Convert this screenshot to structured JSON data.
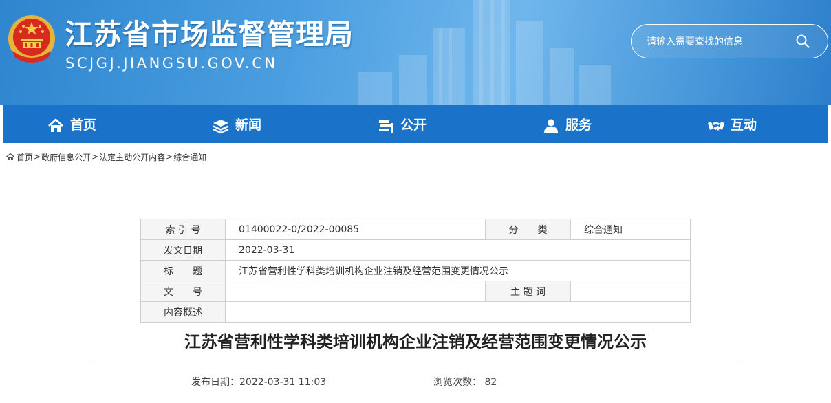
{
  "header": {
    "title": "江苏省市场监督管理局",
    "domain": "SCJGJ.JIANGSU.GOV.CN",
    "search_placeholder": "请输入需要查找的信息",
    "colors": {
      "banner": "#3b8fd7",
      "nav": "#1a73c9"
    }
  },
  "nav": {
    "items": [
      {
        "label": "首页",
        "icon": "home-icon"
      },
      {
        "label": "新闻",
        "icon": "layers-icon"
      },
      {
        "label": "公开",
        "icon": "stack-icon"
      },
      {
        "label": "服务",
        "icon": "user-icon"
      },
      {
        "label": "互动",
        "icon": "handshake-icon"
      }
    ]
  },
  "breadcrumb": {
    "items": [
      "首页",
      "政府信息公开",
      "法定主动公开内容",
      "综合通知"
    ],
    "separator": ">"
  },
  "info_table": {
    "index_label": "索 引 号",
    "index_value": "01400022-0/2022-00085",
    "category_label": "分　　类",
    "category_value": "综合通知",
    "date_label": "发文日期",
    "date_value": "2022-03-31",
    "title_label": "标　　题",
    "title_value": "江苏省营利性学科类培训机构企业注销及经营范围变更情况公示",
    "docno_label": "文　　号",
    "docno_value": "",
    "keyword_label": "主 题 词",
    "keyword_value": "",
    "summary_label": "内容概述",
    "summary_value": ""
  },
  "article": {
    "title": "江苏省营利性学科类培训机构企业注销及经营范围变更情况公示",
    "publish_label": "发布日期：",
    "publish_value": "2022-03-31 11:03",
    "views_label": "浏览次数：",
    "views_value": "82"
  }
}
